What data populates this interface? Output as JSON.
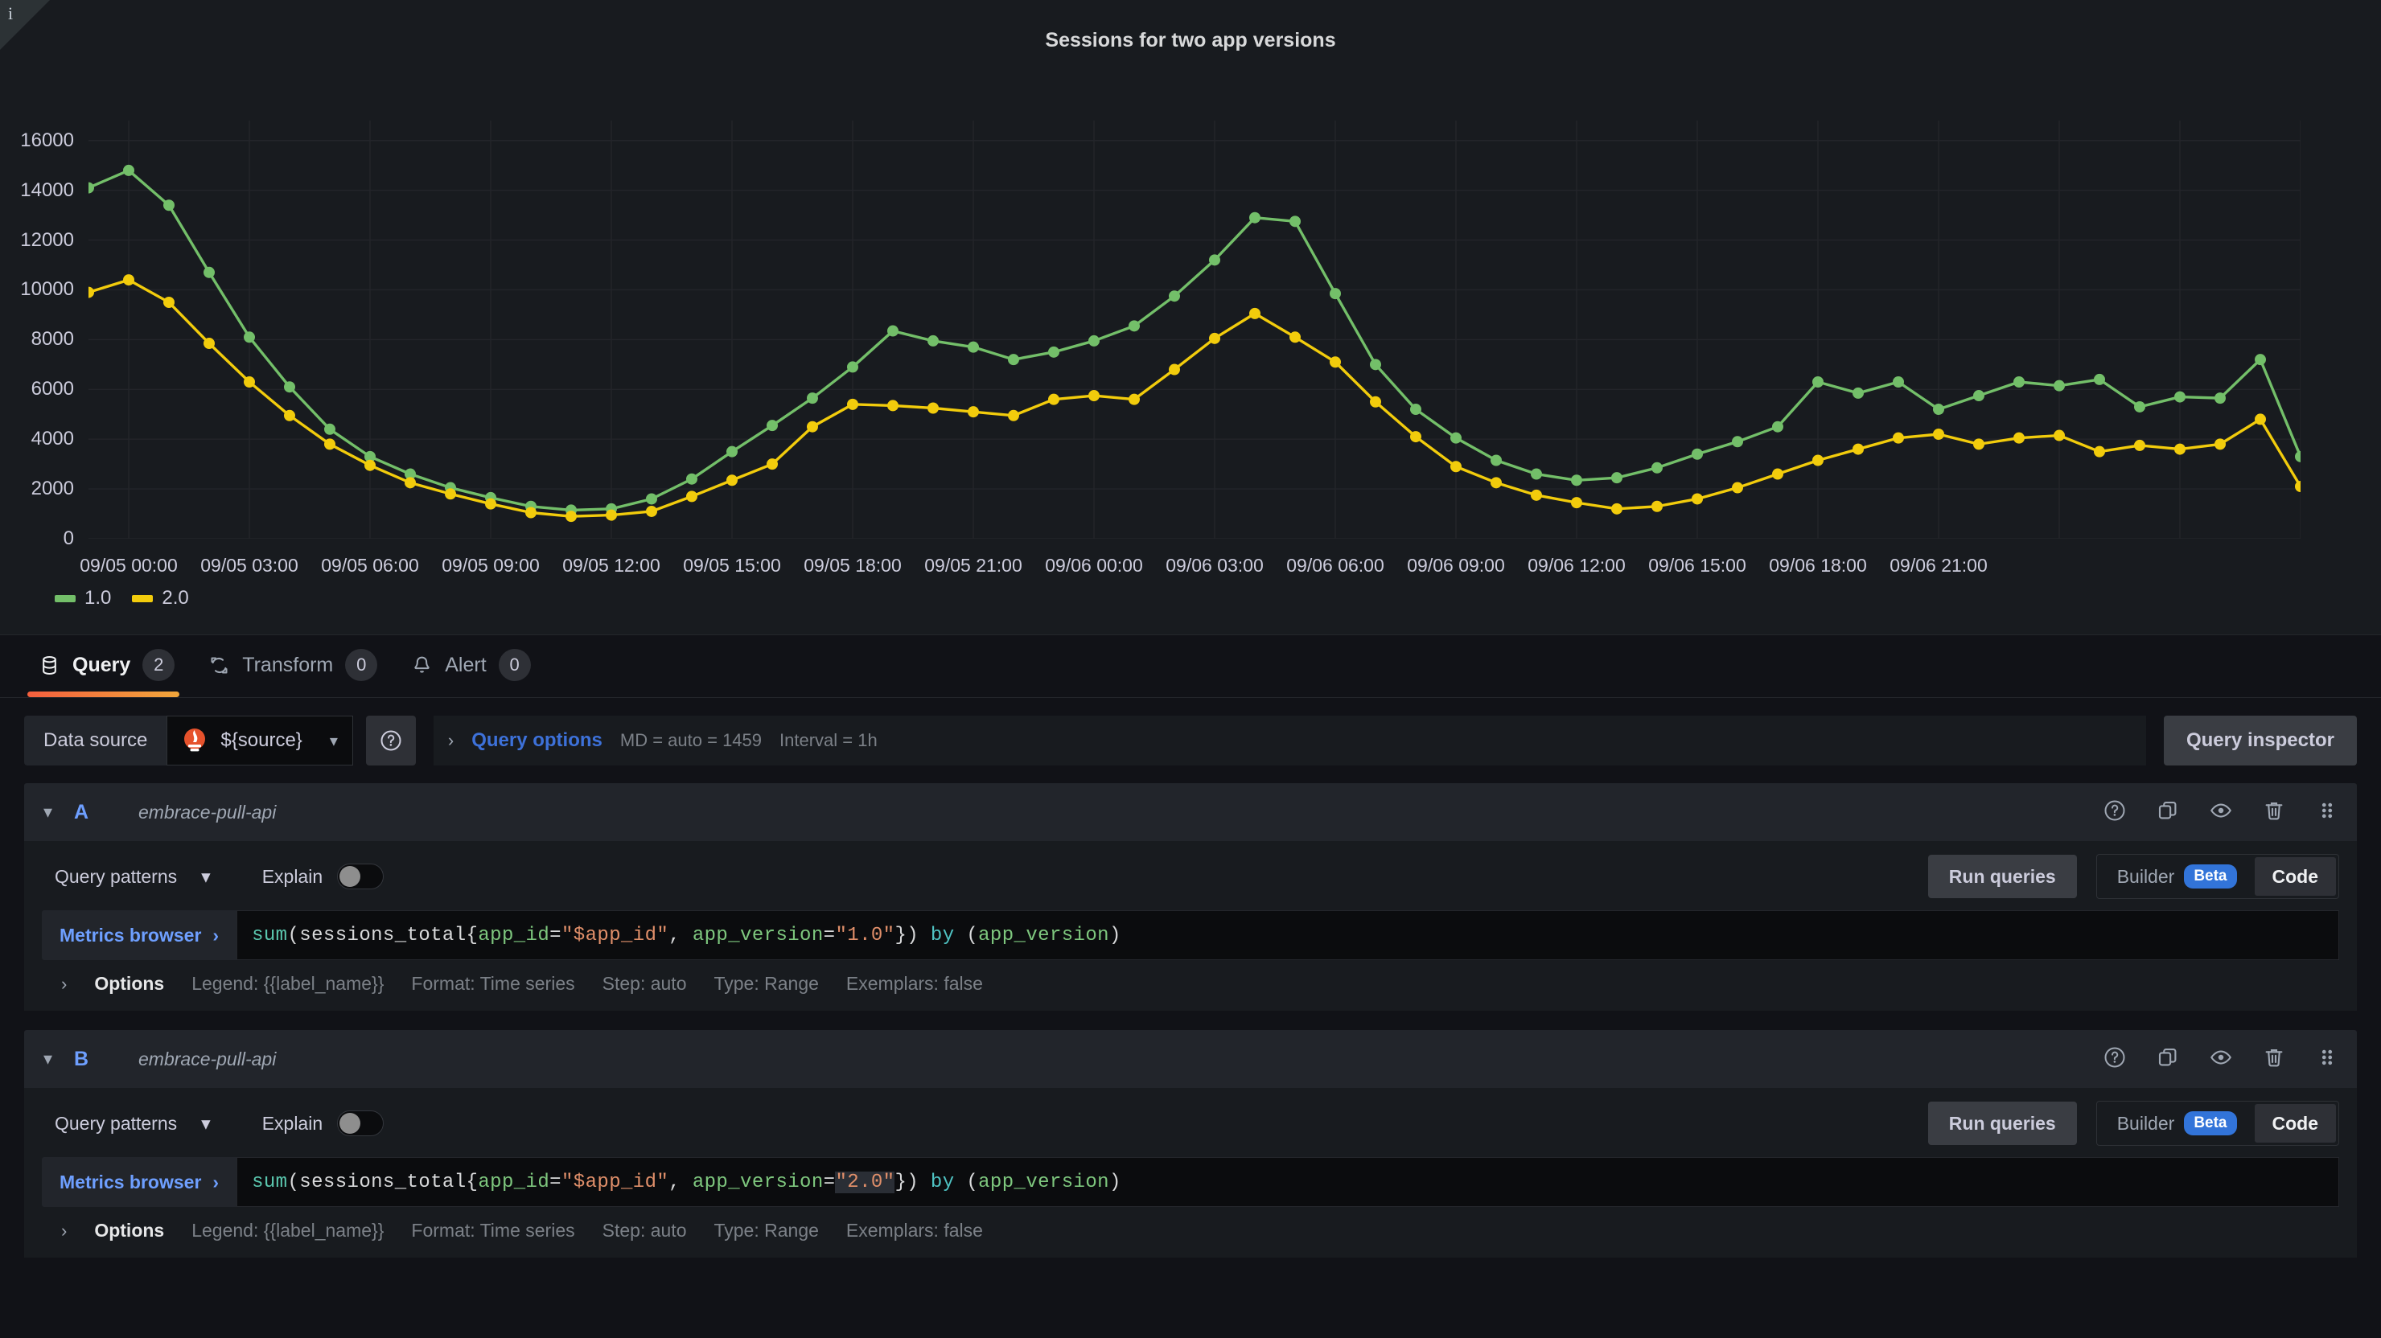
{
  "panel": {
    "info_icon": "info-icon",
    "title": "Sessions for two app versions"
  },
  "chart_data": {
    "type": "line",
    "title": "Sessions for two app versions",
    "xlabel": "",
    "ylabel": "",
    "ylim": [
      0,
      16800
    ],
    "yticks": [
      0,
      2000,
      4000,
      6000,
      8000,
      10000,
      12000,
      14000,
      16000
    ],
    "grid": true,
    "legend_position": "bottom-left",
    "x_tick_labels": [
      "09/05 00:00",
      "09/05 03:00",
      "09/05 06:00",
      "09/05 09:00",
      "09/05 12:00",
      "09/05 15:00",
      "09/05 18:00",
      "09/05 21:00",
      "09/06 00:00",
      "09/06 03:00",
      "09/06 06:00",
      "09/06 09:00",
      "09/06 12:00",
      "09/06 15:00",
      "09/06 18:00",
      "09/06 21:00"
    ],
    "x": [
      "09/04 23:00",
      "09/05 00:00",
      "09/05 01:00",
      "09/05 02:00",
      "09/05 03:00",
      "09/05 04:00",
      "09/05 05:00",
      "09/05 06:00",
      "09/05 07:00",
      "09/05 08:00",
      "09/05 09:00",
      "09/05 10:00",
      "09/05 11:00",
      "09/05 12:00",
      "09/05 13:00",
      "09/05 14:00",
      "09/05 15:00",
      "09/05 16:00",
      "09/05 17:00",
      "09/05 18:00",
      "09/05 19:00",
      "09/05 20:00",
      "09/05 21:00",
      "09/05 22:00",
      "09/05 23:00",
      "09/06 00:00",
      "09/06 01:00",
      "09/06 02:00",
      "09/06 03:00",
      "09/06 04:00",
      "09/06 05:00",
      "09/06 06:00",
      "09/06 07:00",
      "09/06 08:00",
      "09/06 09:00",
      "09/06 10:00",
      "09/06 11:00",
      "09/06 12:00",
      "09/06 13:00",
      "09/06 14:00",
      "09/06 15:00",
      "09/06 16:00",
      "09/06 17:00",
      "09/06 18:00",
      "09/06 19:00",
      "09/06 20:00",
      "09/06 21:00",
      "09/06 22:00"
    ],
    "series": [
      {
        "name": "1.0",
        "color": "#73bf69",
        "values": [
          14100,
          14800,
          13400,
          10700,
          8100,
          6100,
          4400,
          3300,
          2600,
          2050,
          1650,
          1300,
          1150,
          1200,
          1600,
          2400,
          3500,
          4550,
          5650,
          6900,
          8350,
          7950,
          7700,
          7200,
          7500,
          7950,
          8550,
          9750,
          11200,
          12900,
          12750,
          9850,
          7000,
          5200,
          4050,
          3150,
          2600,
          2350,
          2450,
          2850,
          3400,
          3900,
          4500,
          6300,
          5850,
          6300,
          5200,
          5750
        ]
      },
      {
        "name": "2.0",
        "color": "#f2cc0c",
        "values": [
          9900,
          10400,
          9500,
          7850,
          6300,
          4950,
          3800,
          2950,
          2250,
          1800,
          1400,
          1050,
          900,
          950,
          1100,
          1700,
          2350,
          3000,
          4500,
          5400,
          5350,
          5250,
          5100,
          4950,
          5600,
          5750,
          5600,
          6800,
          8050,
          9050,
          8100,
          7100,
          5500,
          4100,
          2900,
          2250,
          1750,
          1450,
          1200,
          1300,
          1600,
          2050,
          2600,
          3150,
          3600,
          4050,
          4200,
          3800
        ]
      }
    ],
    "series_tail_1_0": [
      5750,
      6300,
      6150,
      6400,
      5300,
      5700,
      5650,
      7200,
      3300
    ],
    "series_tail_2_0": [
      3800,
      4050,
      4150,
      3500,
      3750,
      3600,
      3800,
      4800,
      2100
    ]
  },
  "tabs": [
    {
      "label": "Query",
      "badge": "2",
      "icon": "database-icon",
      "active": true
    },
    {
      "label": "Transform",
      "badge": "0",
      "icon": "transform-icon",
      "active": false
    },
    {
      "label": "Alert",
      "badge": "0",
      "icon": "bell-icon",
      "active": false
    }
  ],
  "datasource_row": {
    "label": "Data source",
    "selected": "${source}",
    "logo_icon": "prometheus-icon",
    "caret_icon": "chevron-down-icon",
    "help_icon": "question-circle-icon",
    "query_options": {
      "caret_icon": "chevron-right-icon",
      "title": "Query options",
      "max_data_points": "MD = auto = 1459",
      "interval": "Interval = 1h"
    },
    "query_inspector": "Query inspector"
  },
  "queries": [
    {
      "id": "A",
      "chevron_icon": "chevron-down-icon",
      "datasource": "embrace-pull-api",
      "actions": [
        "help-icon",
        "duplicate-icon",
        "eye-icon",
        "trash-icon",
        "drag-handle-icon"
      ],
      "query_patterns": "Query patterns",
      "query_patterns_caret": "chevron-down-icon",
      "explain_label": "Explain",
      "explain_on": false,
      "run_queries": "Run queries",
      "mode_builder": "Builder",
      "mode_beta": "Beta",
      "mode_code": "Code",
      "mode_selected": "Code",
      "metrics_browser": "Metrics browser",
      "metrics_browser_caret": "chevron-right-icon",
      "expression": "sum(sessions_total{app_id=\"$app_id\", app_version=\"1.0\"}) by (app_version)",
      "expr_tokens": [
        {
          "t": "sum",
          "c": "fn"
        },
        {
          "t": "(sessions_total{",
          "c": "pln"
        },
        {
          "t": "app_id",
          "c": "lbl"
        },
        {
          "t": "=",
          "c": "pln"
        },
        {
          "t": "\"$app_id\"",
          "c": "str"
        },
        {
          "t": ", ",
          "c": "pln"
        },
        {
          "t": "app_version",
          "c": "lbl"
        },
        {
          "t": "=",
          "c": "pln"
        },
        {
          "t": "\"1.0\"",
          "c": "str"
        },
        {
          "t": "}) ",
          "c": "pln"
        },
        {
          "t": "by",
          "c": "kw"
        },
        {
          "t": " (",
          "c": "pln"
        },
        {
          "t": "app_version",
          "c": "lbl"
        },
        {
          "t": ")",
          "c": "pln"
        }
      ],
      "options": {
        "caret_icon": "chevron-right-icon",
        "title": "Options",
        "items": [
          "Legend: {{label_name}}",
          "Format: Time series",
          "Step: auto",
          "Type: Range",
          "Exemplars: false"
        ]
      }
    },
    {
      "id": "B",
      "chevron_icon": "chevron-down-icon",
      "datasource": "embrace-pull-api",
      "actions": [
        "help-icon",
        "duplicate-icon",
        "eye-icon",
        "trash-icon",
        "drag-handle-icon"
      ],
      "query_patterns": "Query patterns",
      "query_patterns_caret": "chevron-down-icon",
      "explain_label": "Explain",
      "explain_on": false,
      "run_queries": "Run queries",
      "mode_builder": "Builder",
      "mode_beta": "Beta",
      "mode_code": "Code",
      "mode_selected": "Code",
      "metrics_browser": "Metrics browser",
      "metrics_browser_caret": "chevron-right-icon",
      "expression": "sum(sessions_total{app_id=\"$app_id\", app_version=\"2.0\"}) by (app_version)",
      "expr_tokens": [
        {
          "t": "sum",
          "c": "fn"
        },
        {
          "t": "(sessions_total{",
          "c": "pln"
        },
        {
          "t": "app_id",
          "c": "lbl"
        },
        {
          "t": "=",
          "c": "pln"
        },
        {
          "t": "\"$app_id\"",
          "c": "str"
        },
        {
          "t": ", ",
          "c": "pln"
        },
        {
          "t": "app_version",
          "c": "lbl"
        },
        {
          "t": "=",
          "c": "pln"
        },
        {
          "t": "\"2.0\"",
          "c": "str",
          "sel": true
        },
        {
          "t": "}) ",
          "c": "pln"
        },
        {
          "t": "by",
          "c": "kw"
        },
        {
          "t": " (",
          "c": "pln"
        },
        {
          "t": "app_version",
          "c": "lbl"
        },
        {
          "t": ")",
          "c": "pln"
        }
      ],
      "options": {
        "caret_icon": "chevron-right-icon",
        "title": "Options",
        "items": [
          "Legend: {{label_name}}",
          "Format: Time series",
          "Step: auto",
          "Type: Range",
          "Exemplars: false"
        ]
      }
    }
  ],
  "colors": {
    "series_1": "#73bf69",
    "series_2": "#f2cc0c",
    "accent_blue": "#3d71d9",
    "tab_active": "#f55f3e",
    "beta_badge": "#3274d9"
  }
}
